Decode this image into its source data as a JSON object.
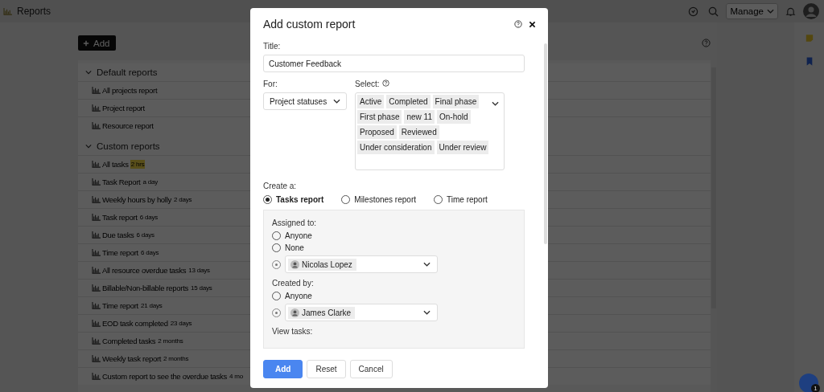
{
  "topbar": {
    "title": "Reports",
    "manage": "Manage"
  },
  "add_button": "Add",
  "sections": [
    {
      "title": "Default reports",
      "expanded": true,
      "items": [
        {
          "name": "All projects report"
        },
        {
          "name": "Project report"
        },
        {
          "name": "Resource report"
        }
      ]
    },
    {
      "title": "Custom reports",
      "expanded": true,
      "items": [
        {
          "name": "All tasks",
          "age": "2 hrs",
          "highlighted": true
        },
        {
          "name": "Task Report",
          "age": "a day",
          "highlighted": false
        },
        {
          "name": "Weekly hours by holly",
          "age": "2 days",
          "highlighted": false
        },
        {
          "name": "Task report",
          "age": "6 days",
          "highlighted": false
        },
        {
          "name": "Due tasks",
          "age": "6 days",
          "highlighted": false
        },
        {
          "name": "Time report",
          "age": "6 days",
          "highlighted": false
        },
        {
          "name": "All resource overdue tasks",
          "age": "13 days",
          "highlighted": false
        },
        {
          "name": "Billable/Non-billable reports",
          "age": "15 days",
          "highlighted": false
        },
        {
          "name": "Time report",
          "age": "21 days",
          "highlighted": false
        },
        {
          "name": "EOD task completed",
          "age": "23 days",
          "highlighted": false
        },
        {
          "name": "Completed tasks",
          "age": "2 months",
          "highlighted": false
        },
        {
          "name": "Weekly task report",
          "age": "2 months",
          "highlighted": false
        },
        {
          "name": "Custom report to see the overdue tasks",
          "age": "4 mo",
          "highlighted": false
        }
      ]
    }
  ],
  "fab_badge": "1",
  "dialog": {
    "title": "Add custom report",
    "title_label": "Title:",
    "title_value": "Customer Feedback",
    "for_label": "For:",
    "for_value": "Project statuses",
    "select_label": "Select:",
    "tags": [
      "Active",
      "Completed",
      "Final phase",
      "First phase",
      "new 11",
      "On-hold",
      "Proposed",
      "Reviewed",
      "Under consideration",
      "Under review"
    ],
    "create_label": "Create a:",
    "report_types": [
      {
        "label": "Tasks report",
        "selected": true
      },
      {
        "label": "Milestones report",
        "selected": false
      },
      {
        "label": "Time report",
        "selected": false
      }
    ],
    "assigned_label": "Assigned to:",
    "assigned_options": [
      {
        "kind": "option",
        "label": "Anyone",
        "selected": false
      },
      {
        "kind": "option",
        "label": "None",
        "selected": false
      },
      {
        "kind": "person",
        "label": "Nicolas Lopez",
        "selected": true
      }
    ],
    "created_label": "Created by:",
    "created_options": [
      {
        "kind": "option",
        "label": "Anyone",
        "selected": false
      },
      {
        "kind": "person",
        "label": "James Clarke",
        "selected": true
      }
    ],
    "view_label": "View tasks:",
    "buttons": [
      {
        "label": "Add",
        "kind": "primary"
      },
      {
        "label": "Reset",
        "kind": "secondary"
      },
      {
        "label": "Cancel",
        "kind": "secondary"
      }
    ]
  }
}
